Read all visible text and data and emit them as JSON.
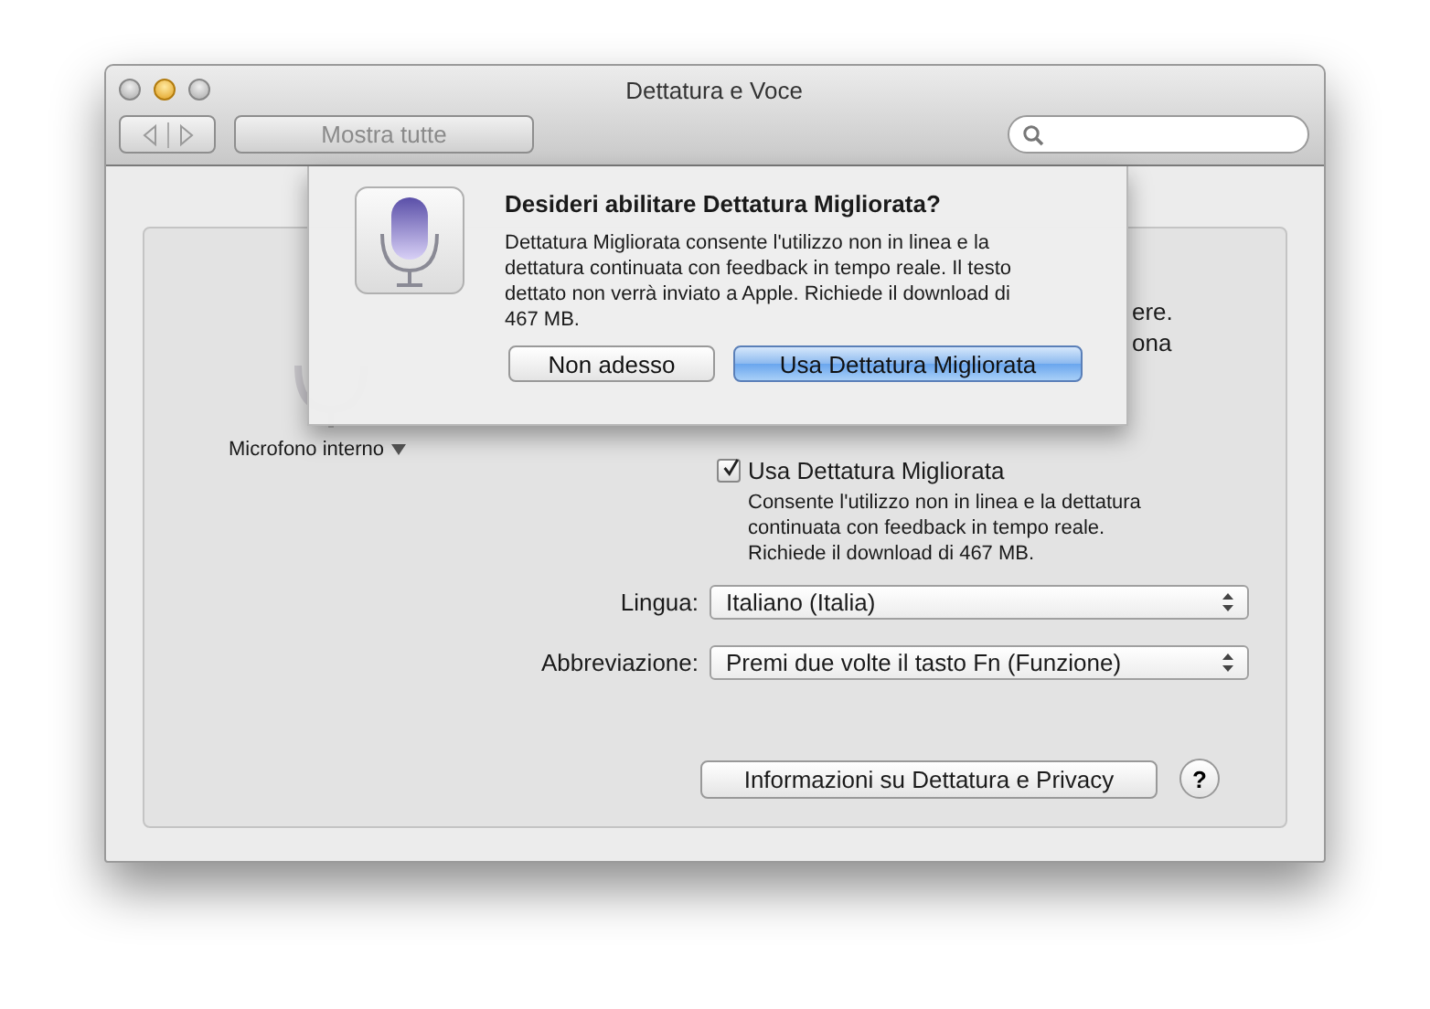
{
  "window": {
    "title": "Dettatura e Voce"
  },
  "toolbar": {
    "show_all_button": "Mostra tutte"
  },
  "panel": {
    "microphone": {
      "label": "Microfono interno"
    },
    "covered_text": [
      "ere.",
      "ona"
    ],
    "enhanced_dictation": {
      "label": "Usa Dettatura Migliorata",
      "checked": true,
      "description": [
        "Consente l'utilizzo non in linea e la dettatura",
        "continuata con feedback in tempo reale.",
        "Richiede il download di 467 MB."
      ]
    },
    "fields": [
      {
        "label": "Lingua:",
        "value": "Italiano (Italia)"
      },
      {
        "label": "Abbreviazione:",
        "value": "Premi due volte il tasto Fn (Funzione)"
      }
    ],
    "privacy_button": "Informazioni su Dettatura e Privacy",
    "help_button": "?"
  },
  "sheet": {
    "title": "Desideri abilitare Dettatura Migliorata?",
    "message": [
      "Dettatura Migliorata consente l'utilizzo non in linea e la",
      "dettatura continuata con feedback in tempo reale. Il testo",
      "dettato non verrà inviato a Apple. Richiede il download di",
      "467 MB."
    ],
    "buttons": [
      {
        "label": "Non adesso",
        "default": false
      },
      {
        "label": "Usa Dettatura Migliorata",
        "default": true
      }
    ]
  }
}
